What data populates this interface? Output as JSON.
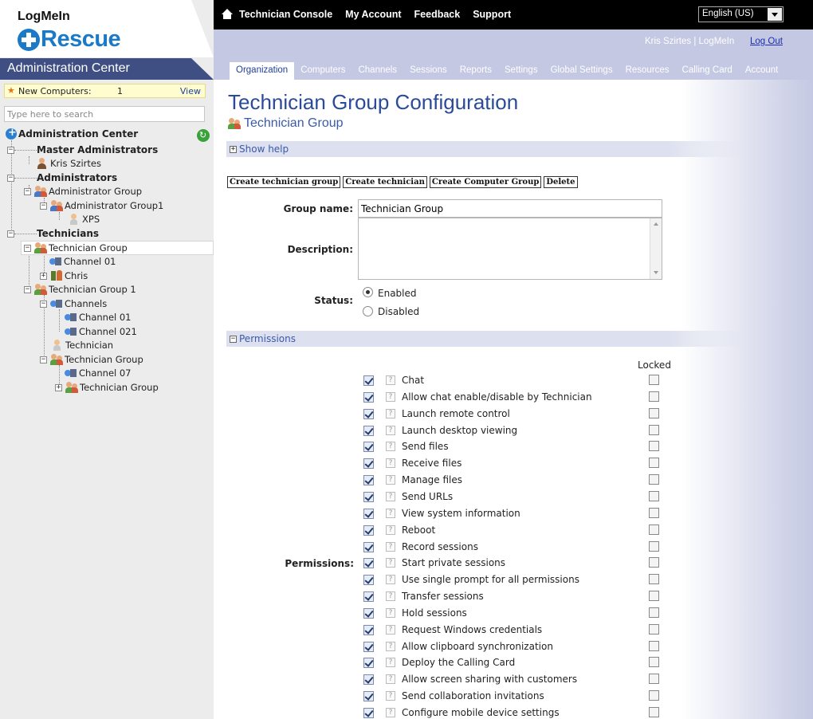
{
  "logo": {
    "brand": "LogMeIn",
    "product": "Rescue"
  },
  "admin_center": {
    "title": "Administration Center"
  },
  "new_computers": {
    "label": "New Computers:",
    "count": "1",
    "view_label": "View"
  },
  "tree_search": {
    "placeholder": "Type here to search"
  },
  "tree": [
    {
      "label": "Administration Center",
      "icon": "rescue-logo-icon",
      "bold": true
    },
    {
      "label": "Master Administrators",
      "bold": true
    },
    {
      "label": "Kris Szirtes",
      "icon": "person-icon"
    },
    {
      "label": "Administrators",
      "bold": true
    },
    {
      "label": "Administrator Group",
      "icon": "group-icon"
    },
    {
      "label": "Administrator Group1",
      "icon": "group-icon"
    },
    {
      "label": "XPS",
      "icon": "technician-icon"
    },
    {
      "label": "Technicians",
      "bold": true
    },
    {
      "label": "Technician Group",
      "icon": "technician-group-icon",
      "selected": true
    },
    {
      "label": "Channel 01",
      "icon": "channel-icon"
    },
    {
      "label": "Chris",
      "icon": "computer-group-icon"
    },
    {
      "label": "Technician Group 1",
      "icon": "technician-group-icon"
    },
    {
      "label": "Channels",
      "icon": "channel-icon"
    },
    {
      "label": "Channel 01",
      "icon": "channel-icon"
    },
    {
      "label": "Channel 021",
      "icon": "channel-icon"
    },
    {
      "label": "Technician",
      "icon": "technician-icon"
    },
    {
      "label": "Technician Group",
      "icon": "technician-group-icon"
    },
    {
      "label": "Channel 07",
      "icon": "channel-icon"
    },
    {
      "label": "Technician Group",
      "icon": "technician-group-icon"
    }
  ],
  "topnav": {
    "items": [
      "Technician Console",
      "My Account",
      "Feedback",
      "Support"
    ],
    "language": "English (US)"
  },
  "user": {
    "name": "Kris Szirtes | LogMeIn",
    "logout": "Log Out"
  },
  "tabs": [
    "Organization",
    "Computers",
    "Channels",
    "Sessions",
    "Reports",
    "Settings",
    "Global Settings",
    "Resources",
    "Calling Card",
    "Account"
  ],
  "active_tab": "Organization",
  "page": {
    "title": "Technician Group Configuration",
    "subtitle": "Technician Group"
  },
  "help_section": {
    "label": "Show help"
  },
  "actions": [
    "Create technician group",
    "Create technician",
    "Create Computer Group",
    "Delete"
  ],
  "form": {
    "group_name_label": "Group name:",
    "group_name_value": "Technician Group",
    "description_label": "Description:",
    "description_value": "",
    "status_label": "Status:",
    "status_enabled": "Enabled",
    "status_disabled": "Disabled",
    "status_value": "Enabled"
  },
  "permissions": {
    "section_label": "Permissions",
    "row_label": "Permissions:",
    "locked_header": "Locked",
    "items": [
      {
        "label": "Chat",
        "checked": true,
        "locked": false
      },
      {
        "label": "Allow chat enable/disable by Technician",
        "checked": true,
        "locked": false
      },
      {
        "label": "Launch remote control",
        "checked": true,
        "locked": false
      },
      {
        "label": "Launch desktop viewing",
        "checked": true,
        "locked": false
      },
      {
        "label": "Send files",
        "checked": true,
        "locked": false
      },
      {
        "label": "Receive files",
        "checked": true,
        "locked": false
      },
      {
        "label": "Manage files",
        "checked": true,
        "locked": false
      },
      {
        "label": "Send URLs",
        "checked": true,
        "locked": false
      },
      {
        "label": "View system information",
        "checked": true,
        "locked": false
      },
      {
        "label": "Reboot",
        "checked": true,
        "locked": false
      },
      {
        "label": "Record sessions",
        "checked": true,
        "locked": false
      },
      {
        "label": "Start private sessions",
        "checked": true,
        "locked": false
      },
      {
        "label": "Use single prompt for all permissions",
        "checked": true,
        "locked": false
      },
      {
        "label": "Transfer sessions",
        "checked": true,
        "locked": false
      },
      {
        "label": "Hold sessions",
        "checked": true,
        "locked": false
      },
      {
        "label": "Request Windows credentials",
        "checked": true,
        "locked": false
      },
      {
        "label": "Allow clipboard synchronization",
        "checked": true,
        "locked": false
      },
      {
        "label": "Deploy the Calling Card",
        "checked": true,
        "locked": false
      },
      {
        "label": "Allow screen sharing with customers",
        "checked": true,
        "locked": false
      },
      {
        "label": "Send collaboration invitations",
        "checked": true,
        "locked": false
      },
      {
        "label": "Configure mobile device settings",
        "checked": true,
        "locked": false
      }
    ]
  }
}
